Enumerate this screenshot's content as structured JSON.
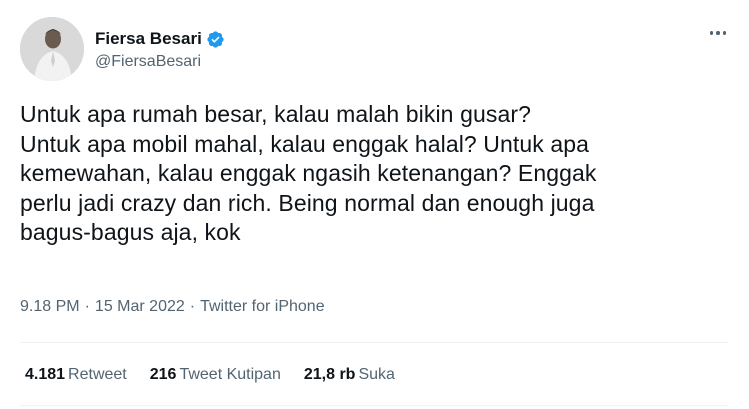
{
  "author": {
    "display_name": "Fiersa Besari",
    "handle": "@FiersaBesari",
    "verified": true
  },
  "tweet": {
    "lines": [
      "Untuk apa rumah besar, kalau malah bikin gusar?",
      "Untuk apa mobil mahal, kalau enggak halal? Untuk apa",
      "kemewahan, kalau enggak ngasih ketenangan? Enggak",
      "perlu jadi crazy dan rich. Being normal dan enough juga",
      "bagus-bagus aja, kok"
    ]
  },
  "meta": {
    "time": "9.18 PM",
    "separator": "·",
    "date": "15 Mar 2022",
    "source": "Twitter for iPhone"
  },
  "stats": {
    "retweets": {
      "count": "4.181",
      "label": "Retweet"
    },
    "quotes": {
      "count": "216",
      "label": "Tweet Kutipan"
    },
    "likes": {
      "count": "21,8 rb",
      "label": "Suka"
    }
  },
  "colors": {
    "text_primary": "#0f1419",
    "text_secondary": "#536471",
    "verified": "#1d9bf0",
    "divider": "#eff3f4"
  },
  "icons": {
    "verified": "verified-badge-icon",
    "more": "more-dots-icon"
  }
}
